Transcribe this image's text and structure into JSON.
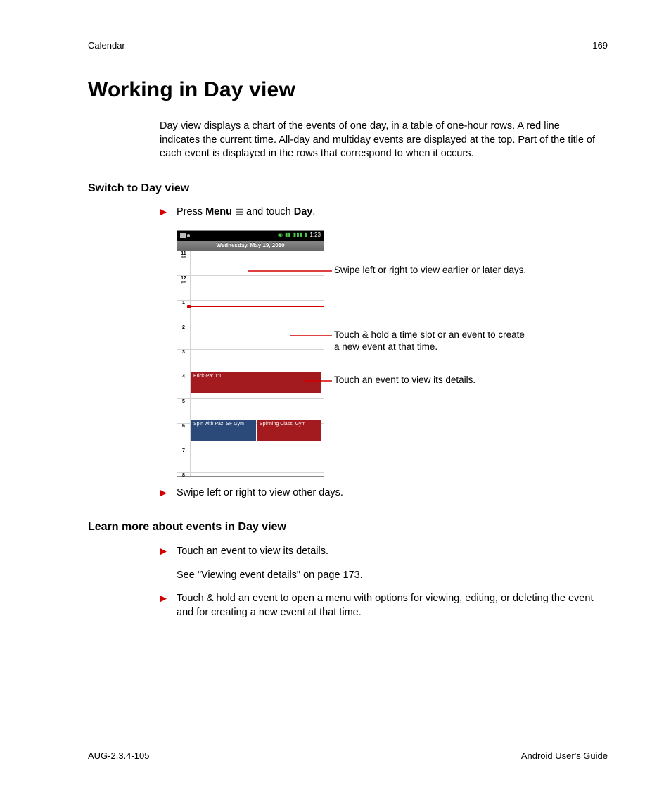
{
  "header": {
    "section": "Calendar",
    "page_number": "169"
  },
  "title": "Working in Day view",
  "intro": "Day view displays a chart of the events of one day, in a table of one-hour rows. A red line indicates the current time. All-day and multiday events are displayed at the top. Part of the title of each event is displayed in the rows that correspond to when it occurs.",
  "section1": {
    "heading": "Switch to Day view",
    "step1_prefix": "Press ",
    "step1_menu": "Menu",
    "step1_mid": " and touch ",
    "step1_day": "Day",
    "step1_suffix": ".",
    "step2": "Swipe left or right to view other days."
  },
  "phone": {
    "status_time": "1:23",
    "date": "Wednesday, May 19, 2010",
    "hours": [
      "11",
      "12",
      "1",
      "2",
      "3",
      "4",
      "5",
      "6",
      "7",
      "8"
    ],
    "ampm": [
      "am",
      "pm",
      "",
      "",
      "",
      "",
      "",
      "",
      "",
      ""
    ],
    "event1": "Erick-Pa: 1:1",
    "event2": "Spin with Paz, SF Gym",
    "event3": "Spinning Class, Gym"
  },
  "callouts": {
    "c1": "Swipe left or right to view earlier or later days.",
    "c2": "Touch & hold a time slot or an event to create a new event at that time.",
    "c3": "Touch an event to view its details."
  },
  "section2": {
    "heading": "Learn more about events in Day view",
    "b1": "Touch an event to view its details.",
    "b1_sub": "See \"Viewing event details\" on page 173.",
    "b2": "Touch & hold an event to open a menu with options for viewing, editing, or deleting the event and for creating a new event at that time."
  },
  "footer": {
    "left": "AUG-2.3.4-105",
    "right": "Android User's Guide"
  }
}
